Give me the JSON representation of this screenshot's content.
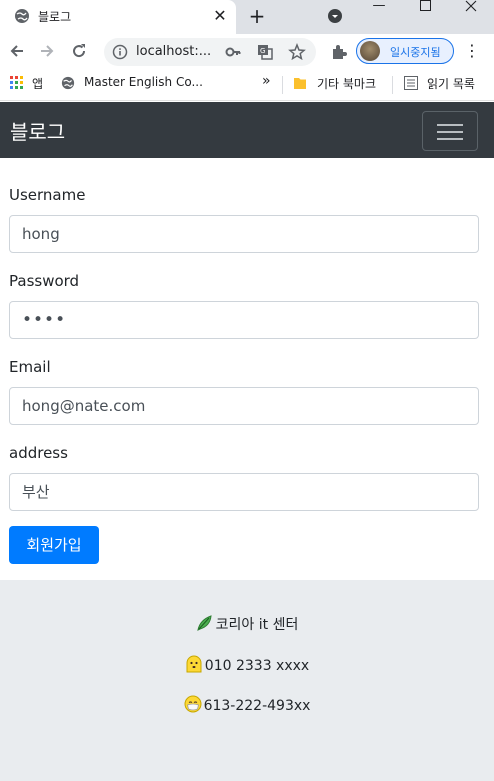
{
  "browser": {
    "tab_title": "블로그",
    "url": "localhost:...",
    "profile_label": "일시중지됨",
    "bookmarks": {
      "apps_label": "앱",
      "item1": "Master English Co...",
      "more": "»",
      "folder1": "기타 북마크",
      "reading_list": "읽기 목록"
    }
  },
  "navbar": {
    "brand": "블로그"
  },
  "form": {
    "username_label": "Username",
    "username_value": "hong",
    "password_label": "Password",
    "password_value": "••••",
    "email_label": "Email",
    "email_value": "hong@nate.com",
    "address_label": "address",
    "address_value": "부산",
    "submit_label": "회원가입"
  },
  "footer": {
    "line1": "코리아 it 센터",
    "line2": "010 2333 xxxx",
    "line3": "613-222-493xx"
  },
  "icons": [
    "globe-icon",
    "close-icon",
    "plus-icon",
    "tab-search-icon",
    "back-icon",
    "forward-icon",
    "reload-icon",
    "info-icon",
    "key-icon",
    "translate-icon",
    "star-icon",
    "extensions-icon",
    "kebab-icon",
    "apps-icon",
    "folder-icon",
    "reading-list-icon",
    "leaf-icon",
    "face-icon",
    "mask-face-icon"
  ],
  "colors": {
    "navbar": "#343a40",
    "primary": "#007bff",
    "footer": "#e9ecef"
  }
}
